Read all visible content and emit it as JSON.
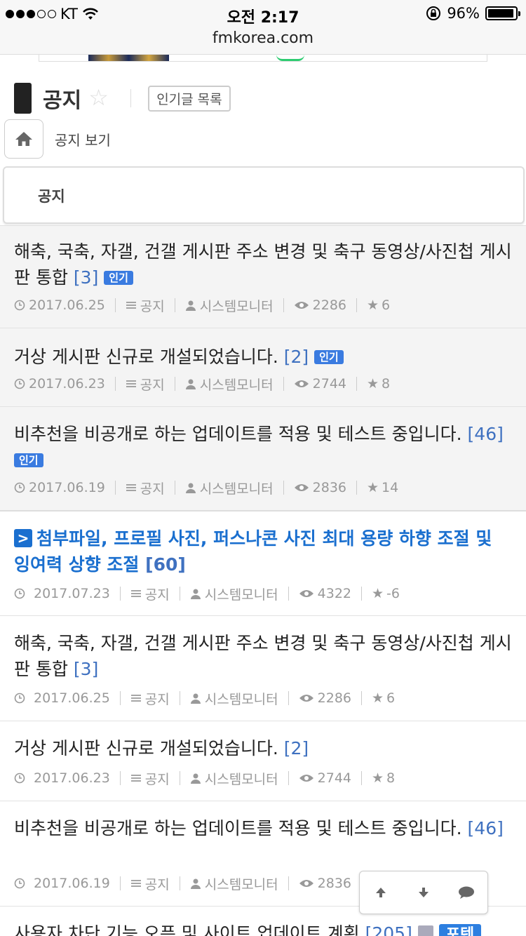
{
  "status_bar": {
    "carrier": "KT",
    "time": "오전 2:17",
    "battery": "96%",
    "battery_level": 0.96
  },
  "url": "fmkorea.com",
  "board": {
    "title": "공지",
    "popular_button": "인기글 목록",
    "home_link": "공지 보기",
    "category": "공지"
  },
  "posts": [
    {
      "title": "해축, 국축, 자갤, 건갤 게시판 주소 변경 및 축구 동영상/사진첩 게시판 통합",
      "comments": "[3]",
      "badge": "인기",
      "date": "2017.06.25",
      "category": "공지",
      "author": "시스템모니터",
      "views": "2286",
      "votes": "6"
    },
    {
      "title": "거상 게시판 신규로 개설되었습니다.",
      "comments": "[2]",
      "badge": "인기",
      "date": "2017.06.23",
      "category": "공지",
      "author": "시스템모니터",
      "views": "2744",
      "votes": "8"
    },
    {
      "title": "비추천을 비공개로 하는 업데이트를 적용 및 테스트 중입니다.",
      "comments": "[46]",
      "badge": "인기",
      "date": "2017.06.19",
      "category": "공지",
      "author": "시스템모니터",
      "views": "2836",
      "votes": "14"
    },
    {
      "badge_arrow": ">",
      "title": "첨부파일, 프로필 사진, 퍼스나콘 사진 최대 용량 하향 조절 및 잉여력 상향 조절",
      "comments": "[60]",
      "date": "2017.07.23",
      "category": "공지",
      "author": "시스템모니터",
      "views": "4322",
      "votes": "-6"
    },
    {
      "title": "해축, 국축, 자갤, 건갤 게시판 주소 변경 및 축구 동영상/사진첩 게시판 통합",
      "comments": "[3]",
      "date": "2017.06.25",
      "category": "공지",
      "author": "시스템모니터",
      "views": "2286",
      "votes": "6"
    },
    {
      "title": "거상 게시판 신규로 개설되었습니다.",
      "comments": "[2]",
      "date": "2017.06.23",
      "category": "공지",
      "author": "시스템모니터",
      "views": "2744",
      "votes": "8"
    },
    {
      "title": "비추천을 비공개로 하는 업데이트를 적용 및 테스트 중입니다.",
      "comments": "[46]",
      "date": "2017.06.19",
      "category": "공지",
      "author": "시스템모니터",
      "views": "2836",
      "votes": ""
    },
    {
      "title": "사용자 차단 기능 오픈 및 사이트 업데이트 계획",
      "comments": "[205]",
      "badge2": "포텐"
    }
  ]
}
